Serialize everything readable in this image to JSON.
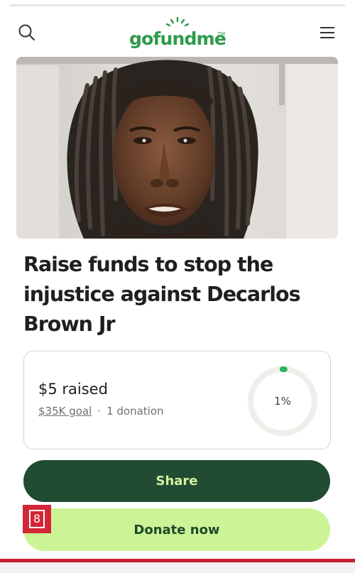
{
  "header": {
    "logo_text": "gofundme",
    "logo_tm": "TM",
    "search_icon": "search-icon",
    "menu_icon": "hamburger-menu-icon"
  },
  "hero": {
    "alt": "photo of campaign subject"
  },
  "campaign": {
    "title": "Raise funds to stop the injustice against Decarlos Brown Jr"
  },
  "progress": {
    "raised_text": "$5 raised",
    "goal_text": "$35K goal",
    "separator": "·",
    "donations_text": "1 donation",
    "percent_text": "1%",
    "percent_value": 1
  },
  "actions": {
    "share_label": "Share",
    "donate_label": "Donate now"
  },
  "tag": {
    "number": "8"
  },
  "colors": {
    "brand_green": "#2e9a4c",
    "share_bg": "#214b33",
    "share_text": "#d2f29e",
    "donate_bg": "#ccf496",
    "donate_text": "#1d4a2b",
    "tag_red": "#d32636"
  }
}
